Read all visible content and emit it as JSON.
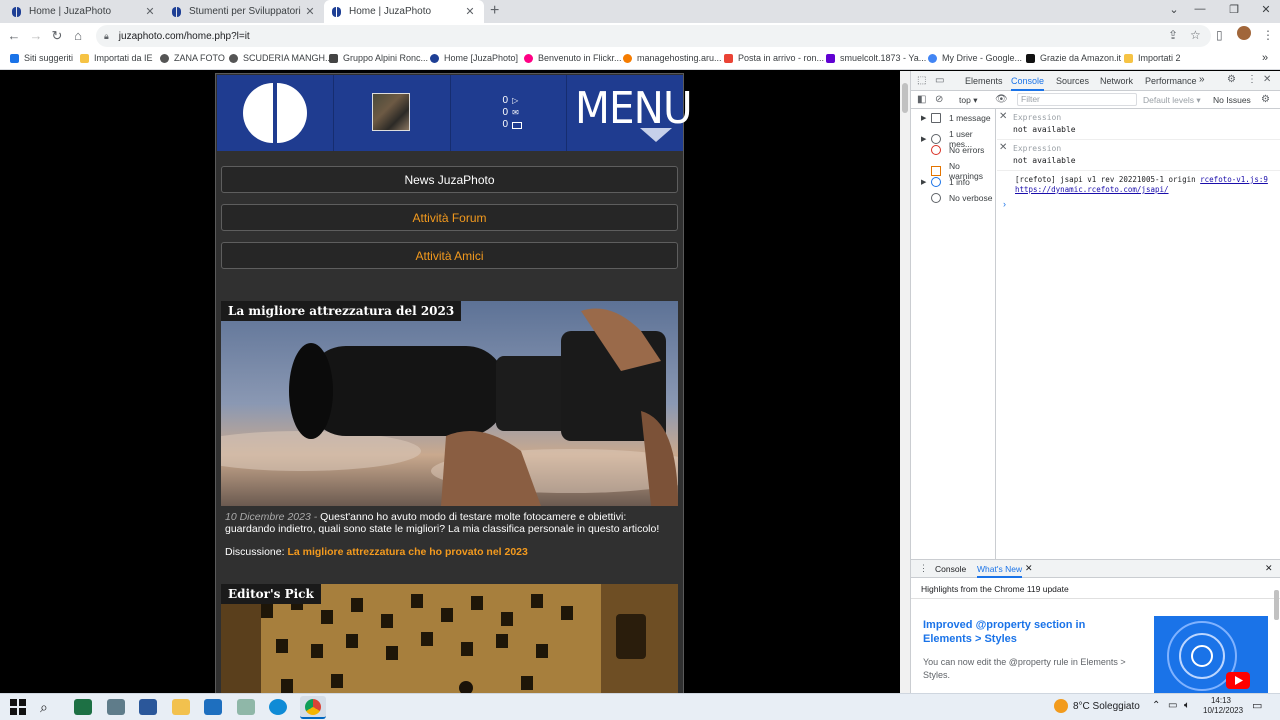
{
  "browser": {
    "tabs": [
      {
        "title": "Home | JuzaPhoto",
        "active": false
      },
      {
        "title": "Stumenti per Sviluppatori | Juza",
        "active": false
      },
      {
        "title": "Home | JuzaPhoto",
        "active": true
      }
    ],
    "new_tab": "+",
    "url": "juzaphoto.com/home.php?l=it",
    "bookmarks": [
      "Siti suggeriti",
      "Importati da IE",
      "ZANA FOTO",
      "SCUDERIA MANGH...",
      "Gruppo Alpini Ronc...",
      "Home [JuzaPhoto]",
      "Benvenuto in Flickr...",
      "managehosting.aru...",
      "Posta in arrivo - ron...",
      "smuelcolt.1873 - Ya...",
      "My Drive - Google...",
      "Grazie da Amazon.it",
      "Importati 2"
    ]
  },
  "site": {
    "header": {
      "counts": [
        "0",
        "0",
        "0"
      ],
      "menu_label": "MENU"
    },
    "buttons": [
      {
        "label": "News JuzaPhoto",
        "color": "#ffffff"
      },
      {
        "label": "Attività Forum",
        "color": "#f39a1e"
      },
      {
        "label": "Attività Amici",
        "color": "#f39a1e"
      }
    ],
    "articles": [
      {
        "title": "La migliore attrezzatura del 2023",
        "date": "10 Dicembre 2023 -",
        "text": "Quest'anno ho avuto modo di testare molte fotocamere e obiettivi: guardando indietro, quali sono state le migliori? La mia classifica personale in questo articolo!",
        "discussion_label": "Discussione:",
        "discussion_link": "La migliore attrezzatura che ho provato nel 2023"
      },
      {
        "title": "Editor's Pick"
      }
    ]
  },
  "devtools": {
    "tabs": [
      "Elements",
      "Console",
      "Sources",
      "Network",
      "Performance"
    ],
    "active_tab": "Console",
    "context": "top",
    "filter_placeholder": "Filter",
    "levels": "Default levels ▾",
    "issues": "No Issues",
    "sidebar": [
      "1 message",
      "1 user mes...",
      "No errors",
      "No warnings",
      "1 info",
      "No verbose"
    ],
    "expressions": [
      {
        "label": "Expression",
        "value": "not available"
      },
      {
        "label": "Expression",
        "value": "not available"
      }
    ],
    "log_text": "[rcefoto] jsapi v1 rev 20221005-1 origin",
    "log_source": "rcefoto-v1.js:9",
    "log_url": "https://dynamic.rcefoto.com/jsapi/",
    "drawer_tabs": [
      "Console",
      "What's New"
    ],
    "drawer_heading": "Highlights from the Chrome 119 update",
    "drawer_article_title": "Improved @property section in Elements > Styles",
    "drawer_article_text": "You can now edit the @property rule in Elements > Styles."
  },
  "taskbar": {
    "weather": "8°C Soleggiato",
    "time": "14:13",
    "date": "10/12/2023"
  },
  "colors": {
    "site_blue": "#1f3c90",
    "orange": "#f39a1e",
    "link_blue": "#1a73e8"
  }
}
